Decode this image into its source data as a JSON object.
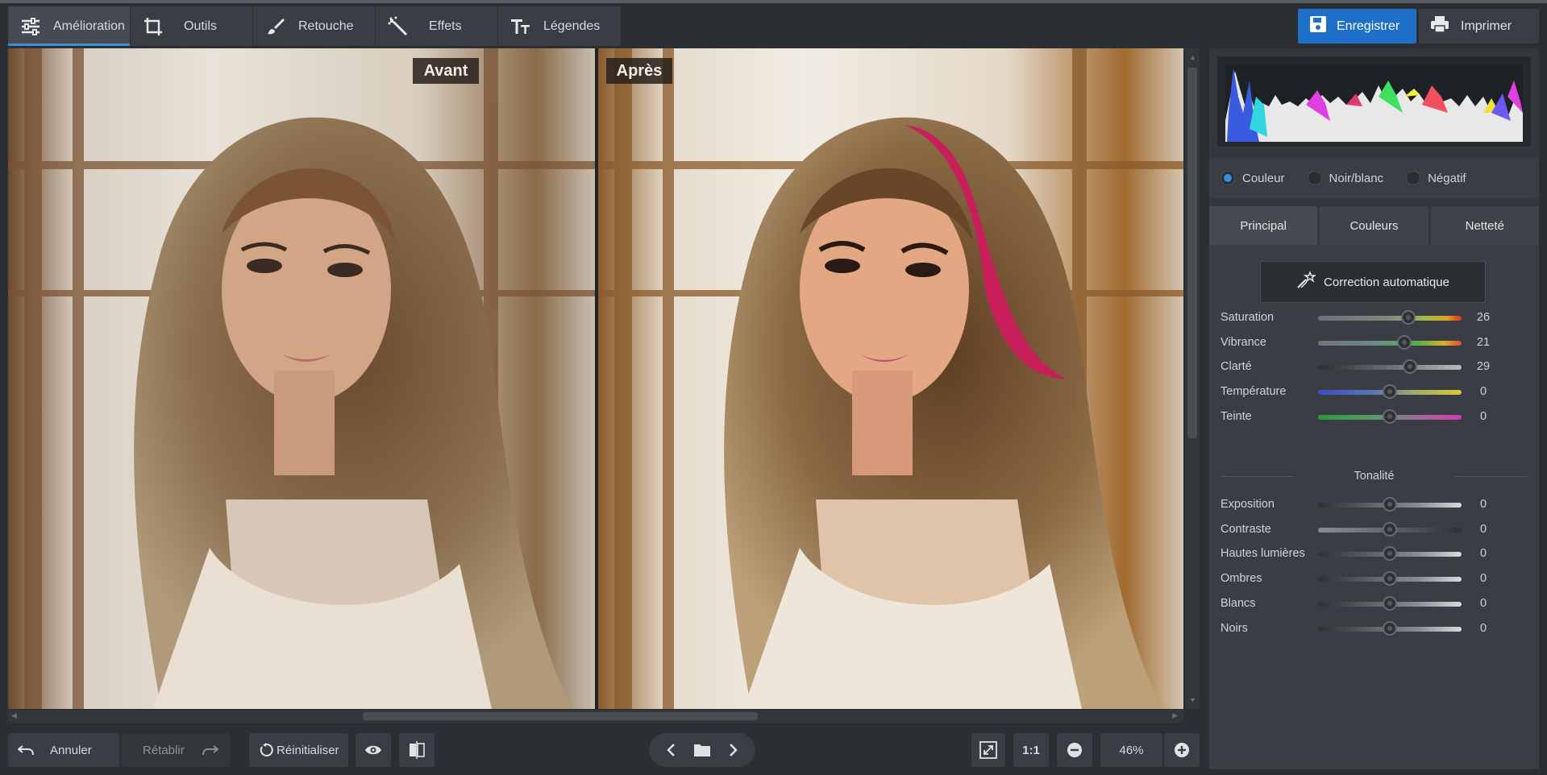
{
  "toolbar": {
    "tabs": [
      {
        "label": "Amélioration",
        "icon": "sliders-icon"
      },
      {
        "label": "Outils",
        "icon": "crop-icon"
      },
      {
        "label": "Retouche",
        "icon": "brush-icon"
      },
      {
        "label": "Effets",
        "icon": "magic-wand-icon"
      },
      {
        "label": "Légendes",
        "icon": "text-icon"
      }
    ],
    "save_label": "Enregistrer",
    "print_label": "Imprimer"
  },
  "viewer": {
    "before_label": "Avant",
    "after_label": "Après"
  },
  "bottom": {
    "undo_label": "Annuler",
    "redo_label": "Rétablir",
    "reset_label": "Réinitialiser",
    "one_to_one": "1:1",
    "zoom": "46%"
  },
  "panel": {
    "modes": [
      {
        "label": "Couleur",
        "selected": true
      },
      {
        "label": "Noir/blanc",
        "selected": false
      },
      {
        "label": "Négatif",
        "selected": false
      }
    ],
    "tabs": [
      "Principal",
      "Couleurs",
      "Netteté"
    ],
    "auto_label": "Correction automatique",
    "section_label": "Tonalité",
    "sliders_main": [
      {
        "label": "Saturation",
        "value": "26",
        "pos": 0.63,
        "gradient": "linear-gradient(90deg,#6c7178,#7f8b7a 50%,#9ac04a 75%,#e0a020 90%,#e03030)"
      },
      {
        "label": "Vibrance",
        "value": "21",
        "pos": 0.6,
        "gradient": "linear-gradient(90deg,#707478,#6a8a8a 40%,#5ab048 70%,#d6b020 88%,#e04a30)"
      },
      {
        "label": "Clarté",
        "value": "29",
        "pos": 0.64,
        "gradient": "linear-gradient(90deg,#2b2e32,#6a6e74 50%,#b8bcc0)"
      },
      {
        "label": "Température",
        "value": "0",
        "pos": 0.5,
        "gradient": "linear-gradient(90deg,#3a4cc8,#5a7ab0 40%,#9aa870 65%,#d8c83a)"
      },
      {
        "label": "Teinte",
        "value": "0",
        "pos": 0.5,
        "gradient": "linear-gradient(90deg,#2e9a3a,#5a9a6a 40%,#a06a9a 70%,#d03ab0)"
      }
    ],
    "sliders_tone": [
      {
        "label": "Exposition",
        "value": "0",
        "pos": 0.5,
        "gradient": "linear-gradient(90deg,#2d3034,#8a8e94 70%,#d8dbde)"
      },
      {
        "label": "Contraste",
        "value": "0",
        "pos": 0.5,
        "gradient": "linear-gradient(90deg,#8a8e94,#60646a 50%,#2d3034)"
      },
      {
        "label": "Hautes lumières",
        "value": "0",
        "pos": 0.5,
        "gradient": "linear-gradient(90deg,#2d3034,#8a8e94 70%,#d8dbde)"
      },
      {
        "label": "Ombres",
        "value": "0",
        "pos": 0.5,
        "gradient": "linear-gradient(90deg,#2d3034,#8a8e94 70%,#d8dbde)"
      },
      {
        "label": "Blancs",
        "value": "0",
        "pos": 0.5,
        "gradient": "linear-gradient(90deg,#2d3034,#8a8e94 70%,#d8dbde)"
      },
      {
        "label": "Noirs",
        "value": "0",
        "pos": 0.5,
        "gradient": "linear-gradient(90deg,#2d3034,#8a8e94 70%,#d8dbde)"
      }
    ]
  }
}
